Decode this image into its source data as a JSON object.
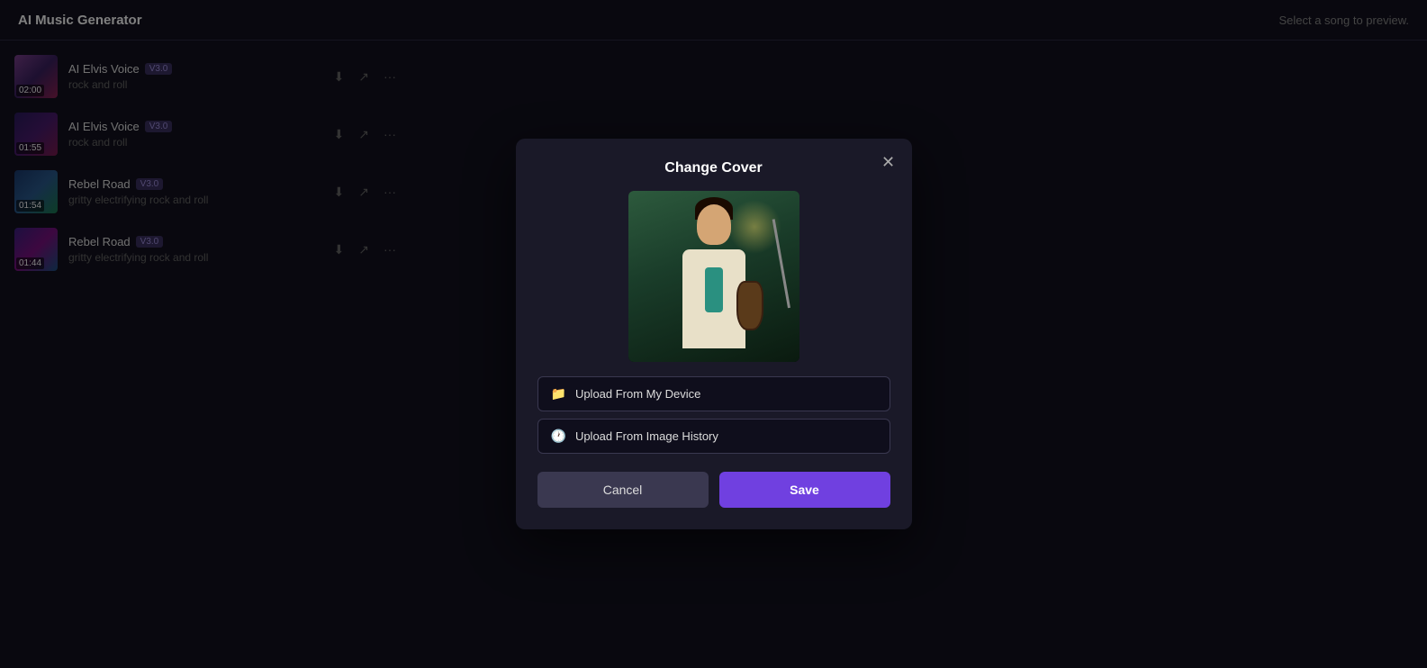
{
  "app": {
    "title": "AI Music Generator",
    "header_hint": "Select a song to preview."
  },
  "songs": [
    {
      "id": 1,
      "name": "AI Elvis Voice",
      "version": "V3.0",
      "genre": "rock and roll",
      "duration": "02:00",
      "thumb_class": "thumb-gradient-1"
    },
    {
      "id": 2,
      "name": "AI Elvis Voice",
      "version": "V3.0",
      "genre": "rock and roll",
      "duration": "01:55",
      "thumb_class": "thumb-gradient-2"
    },
    {
      "id": 3,
      "name": "Rebel Road",
      "version": "V3.0",
      "genre": "gritty electrifying rock and roll",
      "duration": "01:54",
      "thumb_class": "thumb-gradient-3"
    },
    {
      "id": 4,
      "name": "Rebel Road",
      "version": "V3.0",
      "genre": "gritty electrifying rock and roll",
      "duration": "01:44",
      "thumb_class": "thumb-gradient-4"
    }
  ],
  "modal": {
    "title": "Change Cover",
    "upload_device_label": "Upload From My Device",
    "upload_history_label": "Upload From Image History",
    "cancel_label": "Cancel",
    "save_label": "Save"
  }
}
